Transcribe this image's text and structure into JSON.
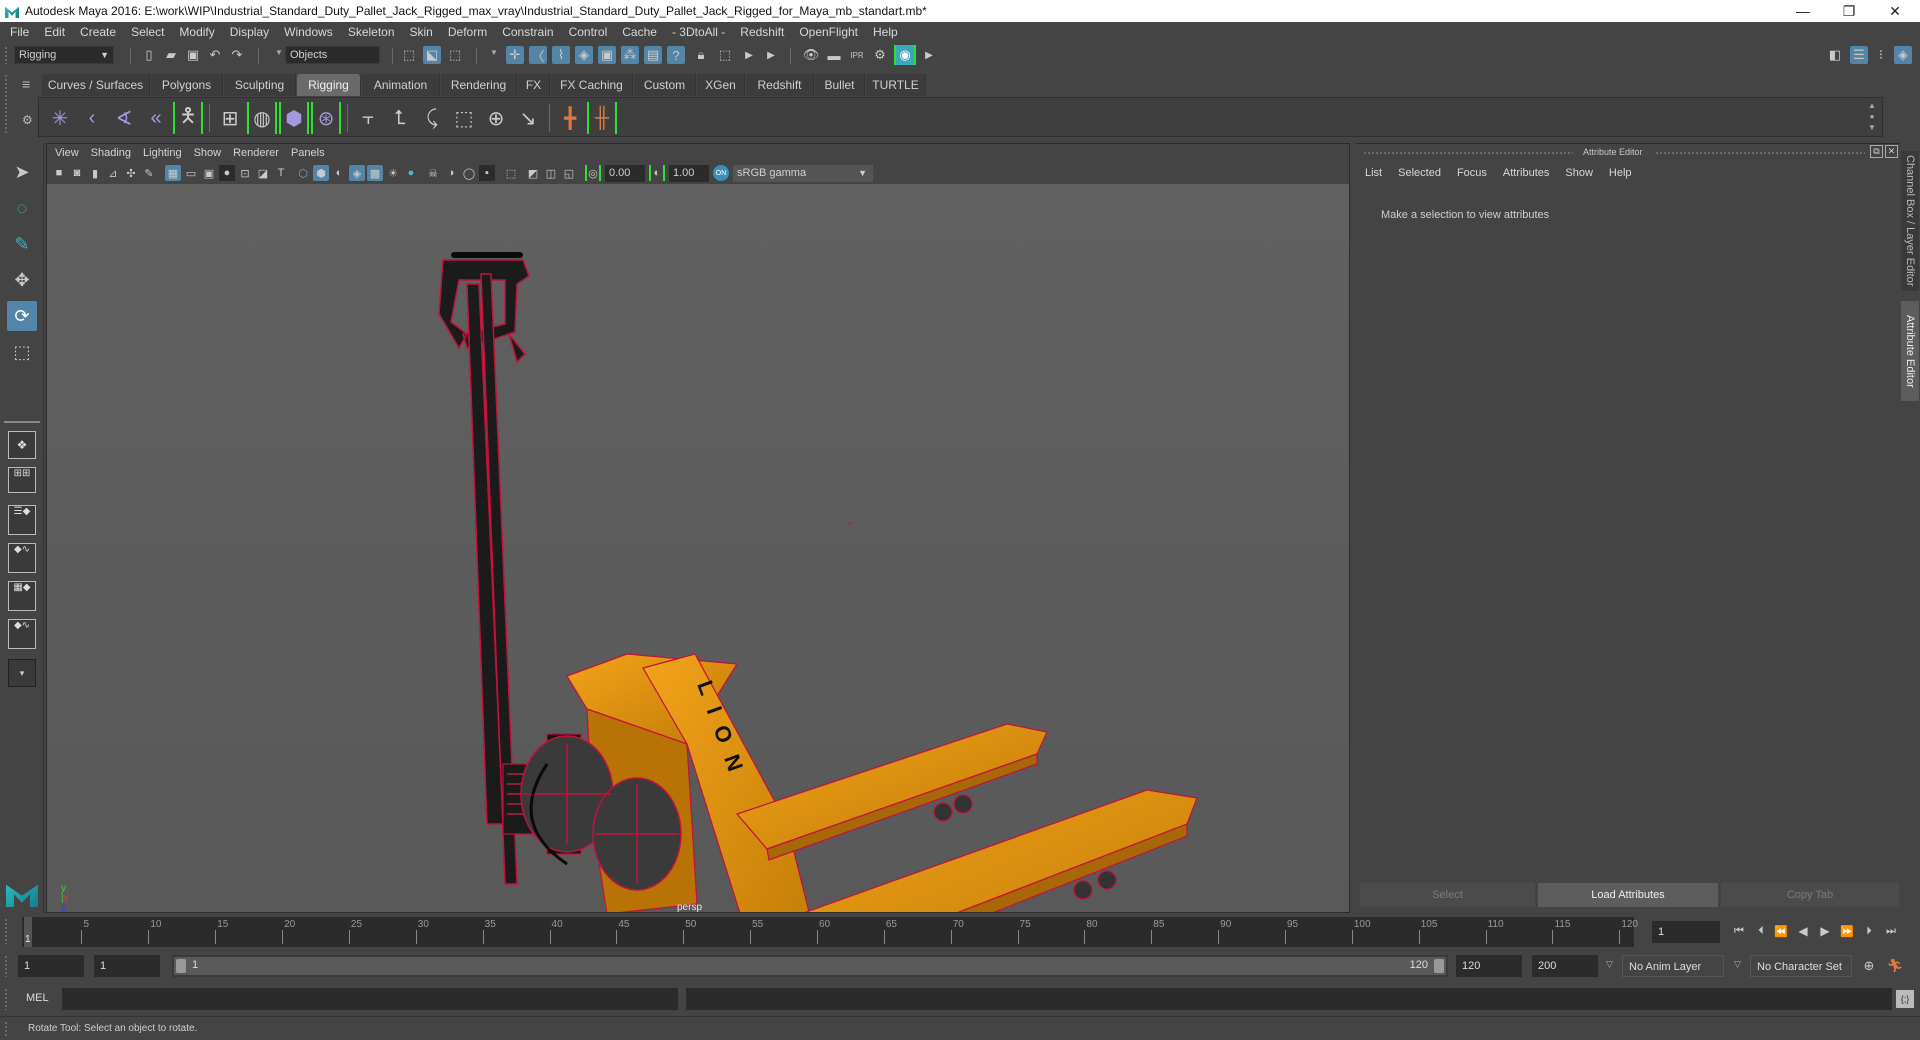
{
  "window": {
    "title": "Autodesk Maya 2016: E:\\work\\WIP\\Industrial_Standard_Duty_Pallet_Jack_Rigged_max_vray\\Industrial_Standard_Duty_Pallet_Jack_Rigged_for_Maya_mb_standart.mb*",
    "minimize": "—",
    "restore": "❐",
    "close": "✕"
  },
  "menubar": [
    "File",
    "Edit",
    "Create",
    "Select",
    "Modify",
    "Display",
    "Windows",
    "Skeleton",
    "Skin",
    "Deform",
    "Constrain",
    "Control",
    "Cache",
    "- 3DtoAll -",
    "Redshift",
    "OpenFlight",
    "Help"
  ],
  "statusline": {
    "menuset": "Rigging",
    "selection_mask": "Objects"
  },
  "shelf": {
    "tabs": [
      "Curves / Surfaces",
      "Polygons",
      "Sculpting",
      "Rigging",
      "Animation",
      "Rendering",
      "FX",
      "FX Caching",
      "Custom",
      "XGen",
      "Redshift",
      "Bullet",
      "TURTLE"
    ],
    "active_tab": "Rigging"
  },
  "viewport": {
    "menus": [
      "View",
      "Shading",
      "Lighting",
      "Show",
      "Renderer",
      "Panels"
    ],
    "exposure": "0.00",
    "gamma": "1.00",
    "color_space": "sRGB gamma",
    "camera_label": "persp",
    "model_logo_text": "LION"
  },
  "attribute_editor": {
    "title": "Attribute Editor",
    "menus": [
      "List",
      "Selected",
      "Focus",
      "Attributes",
      "Show",
      "Help"
    ],
    "message": "Make a selection to view attributes",
    "buttons": {
      "select": "Select",
      "load": "Load Attributes",
      "copy": "Copy Tab"
    }
  },
  "side_tabs": {
    "channel_box": "Channel Box / Layer Editor",
    "attribute_editor": "Attribute Editor"
  },
  "timeline": {
    "tick_labels": [
      "5",
      "10",
      "15",
      "20",
      "25",
      "30",
      "35",
      "40",
      "45",
      "50",
      "55",
      "60",
      "65",
      "70",
      "75",
      "80",
      "85",
      "90",
      "95",
      "100",
      "105",
      "110",
      "115",
      "120"
    ],
    "current_frame_marker": "1",
    "current_frame": "1"
  },
  "range": {
    "start": "1",
    "playback_start": "1",
    "slider_start": "1",
    "slider_end": "120",
    "playback_end": "120",
    "end": "200",
    "anim_layer": "No Anim Layer",
    "character_set": "No Character Set"
  },
  "command_line": {
    "label": "MEL"
  },
  "help_line": "Rotate Tool: Select an object to rotate."
}
